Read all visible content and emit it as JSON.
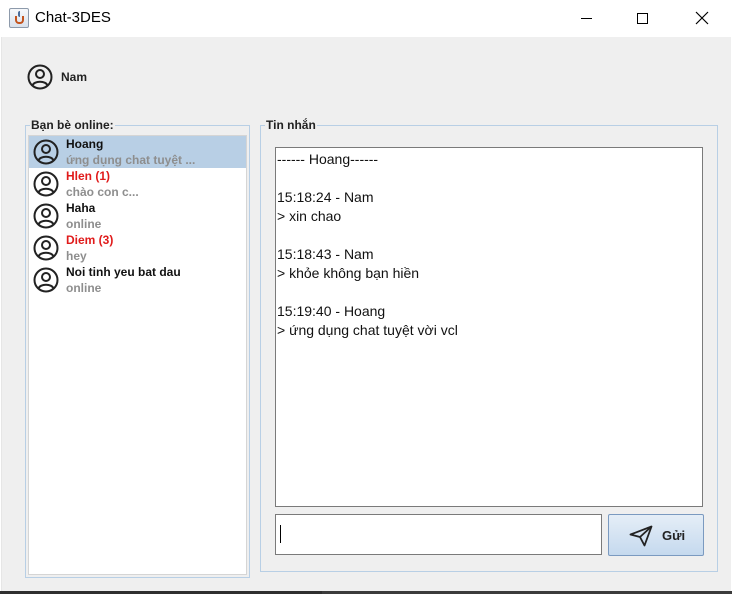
{
  "window": {
    "title": "Chat-3DES",
    "controls": [
      "minimize",
      "maximize",
      "close"
    ]
  },
  "current_user": {
    "name": "Nam",
    "icon": "user-icon"
  },
  "friends_panel": {
    "legend": "Bạn bè online:",
    "friends": [
      {
        "name": "Hoang",
        "preview": "ứng dụng chat tuyệt ...",
        "selected": true,
        "unread": false
      },
      {
        "name": "Hlen (1)",
        "preview": "chào con c...",
        "selected": false,
        "unread": true
      },
      {
        "name": "Haha",
        "preview": "online",
        "selected": false,
        "unread": false
      },
      {
        "name": "Diem (3)",
        "preview": "hey",
        "selected": false,
        "unread": true
      },
      {
        "name": "Noi tinh yeu bat dau",
        "preview": "online",
        "selected": false,
        "unread": false
      }
    ]
  },
  "messages_panel": {
    "legend": "Tin nhắn",
    "lines": [
      "------ Hoang------",
      "",
      "15:18:24 - Nam",
      "> xin chao",
      "",
      "15:18:43 - Nam",
      "> khỏe không bạn hiền",
      "",
      "15:19:40 - Hoang",
      "> ứng dụng chat tuyệt vời vcl"
    ],
    "input_value": "",
    "send_label": "Gửi",
    "send_icon": "paper-plane-icon"
  },
  "colors": {
    "selection": "#b8cfe5",
    "unread": "#e01b1b",
    "preview_text": "#8e8e8e",
    "panel_background": "#efefef"
  }
}
